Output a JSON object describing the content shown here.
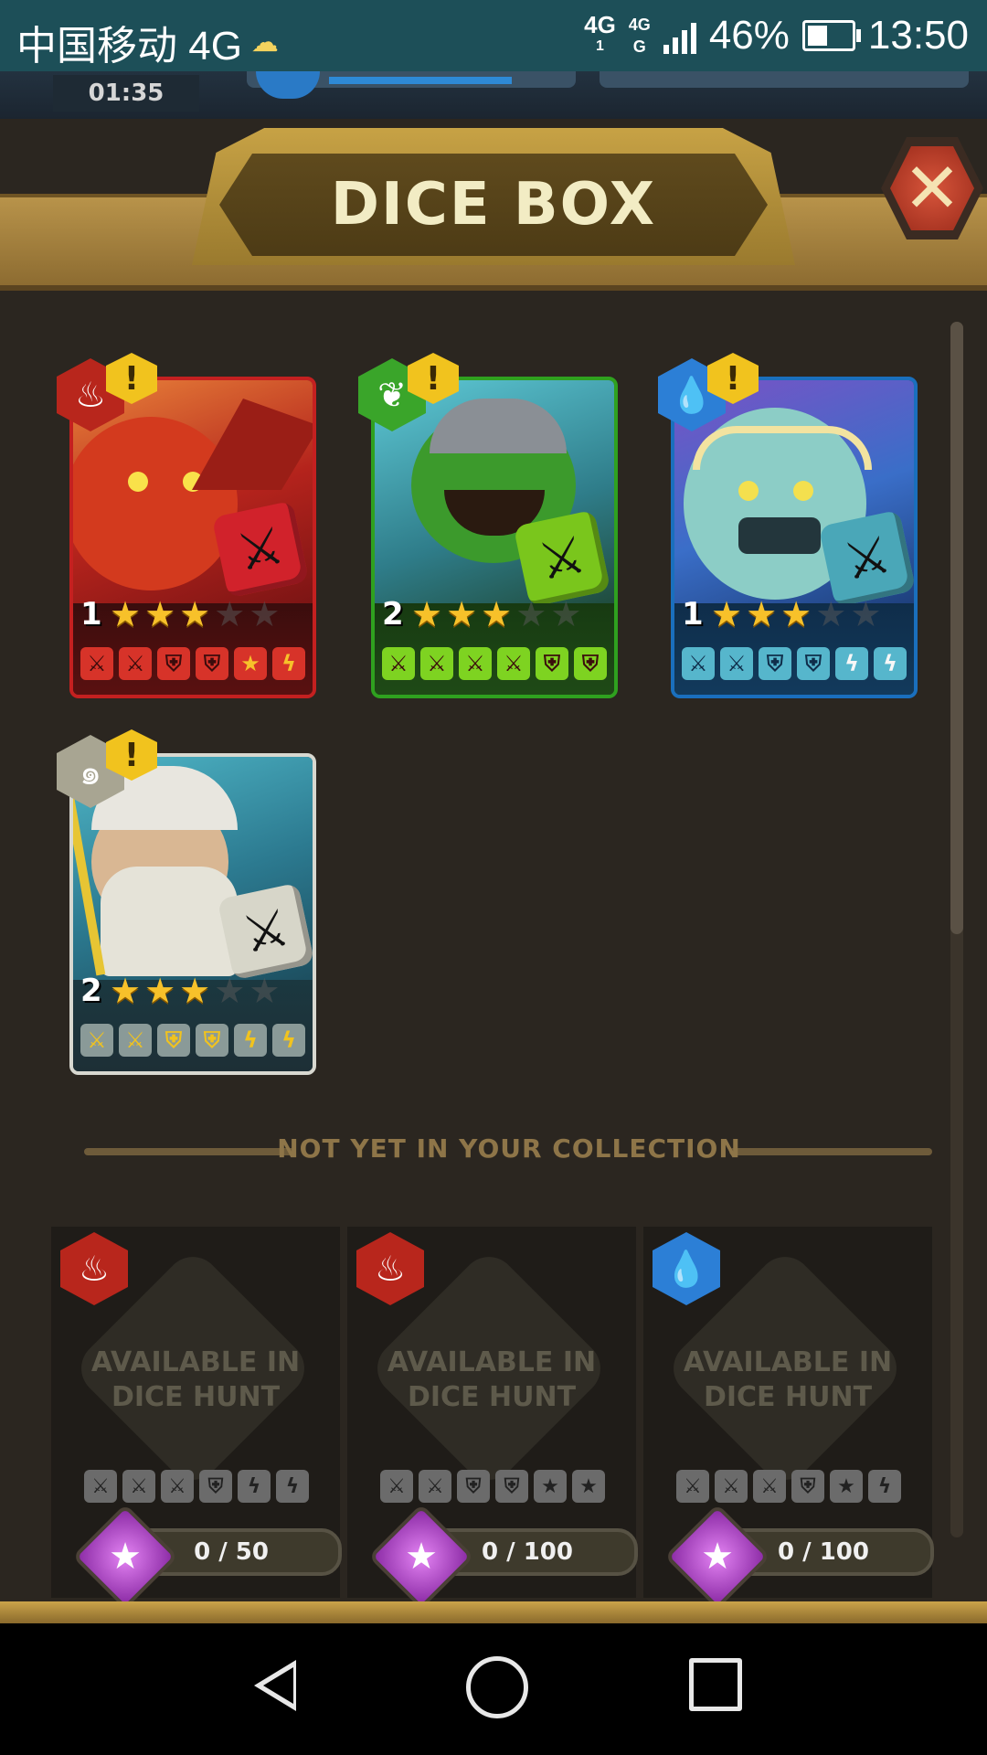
{
  "status_bar": {
    "carrier": "中国移动 4G",
    "weather_icon": "cloud-sun-icon",
    "net_top": "4G",
    "net_top2": "4G",
    "battery_pct": "46%",
    "time": "13:50"
  },
  "hud": {
    "timer": "01:35"
  },
  "title": "DICE BOX",
  "close_icon": "close-x-icon",
  "owned_dice": [
    {
      "element": "fire",
      "level": "1",
      "stars_on": 3,
      "stars_total": 5,
      "color": "#c42020",
      "faces": [
        "⚔",
        "⚔",
        "⛨",
        "⛨",
        "★",
        "ϟ"
      ]
    },
    {
      "element": "nature",
      "level": "2",
      "stars_on": 3,
      "stars_total": 5,
      "color": "#2fa11f",
      "faces": [
        "⚔",
        "⚔",
        "⚔",
        "⚔",
        "⛨",
        "⛨"
      ]
    },
    {
      "element": "water",
      "level": "1",
      "stars_on": 3,
      "stars_total": 5,
      "color": "#1a6fbd",
      "faces": [
        "⚔",
        "⚔",
        "⛨",
        "⛨",
        "ϟ",
        "ϟ"
      ]
    },
    {
      "element": "air",
      "level": "2",
      "stars_on": 3,
      "stars_total": 5,
      "color": "#d8d8d0",
      "faces": [
        "⚔",
        "⚔",
        "⛨",
        "⛨",
        "ϟ",
        "ϟ"
      ]
    }
  ],
  "divider_label": "NOT YET IN YOUR COLLECTION",
  "locked_dice": [
    {
      "element": "fire",
      "line1": "AVAILABLE IN",
      "line2": "DICE HUNT",
      "progress": "0 / 50",
      "faces": [
        "⚔",
        "⚔",
        "⚔",
        "⛨",
        "ϟ",
        "ϟ"
      ]
    },
    {
      "element": "fire",
      "line1": "AVAILABLE IN",
      "line2": "DICE HUNT",
      "progress": "0 / 100",
      "faces": [
        "⚔",
        "⚔",
        "⛨",
        "⛨",
        "★",
        "★"
      ]
    },
    {
      "element": "water",
      "line1": "AVAILABLE IN",
      "line2": "DICE HUNT",
      "progress": "0 / 100",
      "faces": [
        "⚔",
        "⚔",
        "⚔",
        "⛨",
        "★",
        "ϟ"
      ]
    }
  ],
  "nav": {
    "back": "back-icon",
    "home": "home-icon",
    "recents": "recents-icon"
  }
}
